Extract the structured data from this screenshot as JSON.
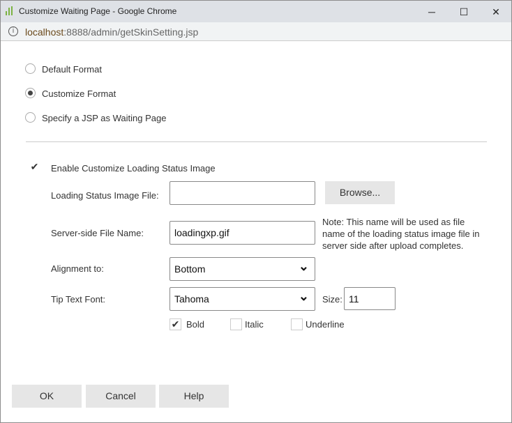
{
  "window": {
    "title": "Customize Waiting Page - Google Chrome",
    "url_host": "localhost",
    "url_path": ":8888/admin/getSkinSetting.jsp",
    "minimize": "─",
    "maximize": "☐",
    "close": "✕"
  },
  "format_options": [
    {
      "label": "Default Format",
      "selected": false
    },
    {
      "label": "Customize Format",
      "selected": true
    },
    {
      "label": "Specify a JSP as Waiting Page",
      "selected": false
    }
  ],
  "enable_image": {
    "label": "Enable Customize Loading Status Image",
    "checked": true
  },
  "image_file": {
    "label": "Loading Status Image File:",
    "value": "",
    "browse": "Browse..."
  },
  "server_file": {
    "label": "Server-side File Name:",
    "value": "loadingxp.gif",
    "note": "Note: This name will be used as file name of the loading status image file in server side after upload completes."
  },
  "alignment": {
    "label": "Alignment to:",
    "value": "Bottom"
  },
  "font": {
    "label": "Tip Text Font:",
    "value": "Tahoma",
    "size_label": "Size:",
    "size": "11"
  },
  "styles": [
    {
      "label": "Bold",
      "checked": true
    },
    {
      "label": "Italic",
      "checked": false
    },
    {
      "label": "Underline",
      "checked": false
    }
  ],
  "buttons": {
    "ok": "OK",
    "cancel": "Cancel",
    "help": "Help"
  }
}
